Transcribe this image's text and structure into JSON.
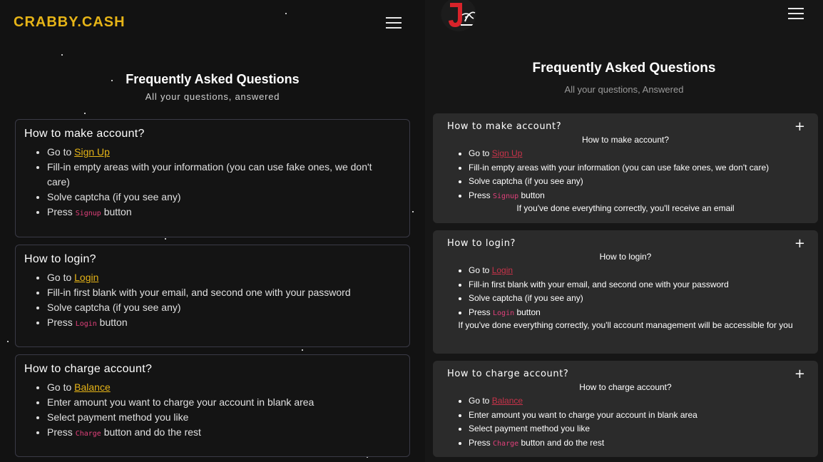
{
  "left": {
    "brand": "CRABBY.CASH",
    "hero": {
      "title": "Frequently Asked Questions",
      "subtitle": "All your questions, answered"
    },
    "cards": [
      {
        "title": "How to make account?",
        "items": [
          {
            "pre": "Go to ",
            "link": "Sign Up",
            "post": ""
          },
          {
            "pre": "Fill-in empty areas with your information (you can use fake ones, we don't care)"
          },
          {
            "pre": "Solve captcha (if you see any)"
          },
          {
            "pre": "Press ",
            "code": "Signup",
            "post": " button"
          }
        ]
      },
      {
        "title": "How to login?",
        "items": [
          {
            "pre": "Go to ",
            "link": "Login",
            "post": ""
          },
          {
            "pre": "Fill-in first blank with your email, and second one with your password"
          },
          {
            "pre": "Solve captcha (if you see any)"
          },
          {
            "pre": "Press ",
            "code": "Login",
            "post": " button"
          }
        ]
      },
      {
        "title": "How to charge account?",
        "items": [
          {
            "pre": "Go to ",
            "link": "Balance",
            "post": ""
          },
          {
            "pre": "Enter amount you want to charge your account in blank area"
          },
          {
            "pre": "Select payment method you like"
          },
          {
            "pre": "Press ",
            "code": "Charge",
            "post": " button and do the rest"
          }
        ]
      }
    ]
  },
  "right": {
    "logo_letter": "J",
    "hero": {
      "title": "Frequently Asked Questions",
      "subtitle": "All your questions, Answered"
    },
    "cards": [
      {
        "title": "How to make account?",
        "toggle": "+",
        "inner_title": "How to make account?",
        "items": [
          {
            "pre": "Go to ",
            "link": "Sign Up",
            "post": ""
          },
          {
            "pre": "Fill-in empty areas with your information (you can use fake ones, we don't care)"
          },
          {
            "pre": "Solve captcha (if you see any)"
          },
          {
            "pre": "Press ",
            "code": "Signup",
            "post": " button"
          }
        ],
        "footer": "If you've done everything correctly, you'll receive an email"
      },
      {
        "title": "How to login?",
        "toggle": "+",
        "inner_title": "How to login?",
        "items": [
          {
            "pre": "Go to ",
            "link": "Login",
            "post": ""
          },
          {
            "pre": "Fill-in first blank with your email, and second one with your password"
          },
          {
            "pre": "Solve captcha (if you see any)"
          },
          {
            "pre": "Press ",
            "code": "Login",
            "post": " button"
          }
        ],
        "footer": "If you've done everything correctly, you'll account management will be accessible for you"
      },
      {
        "title": "How to charge account?",
        "toggle": "+",
        "inner_title": "How to charge account?",
        "items": [
          {
            "pre": "Go to ",
            "link": "Balance",
            "post": ""
          },
          {
            "pre": "Enter amount you want to charge your account in blank area"
          },
          {
            "pre": "Select payment method you like"
          },
          {
            "pre": "Press ",
            "code": "Charge",
            "post": " button and do the rest"
          }
        ],
        "footer": ""
      }
    ]
  },
  "colors": {
    "brand": "#e6b417",
    "code": "#e0407a",
    "link_right": "#c8334a",
    "card_right": "#2b2b2b",
    "logo_red": "#d8232a"
  }
}
